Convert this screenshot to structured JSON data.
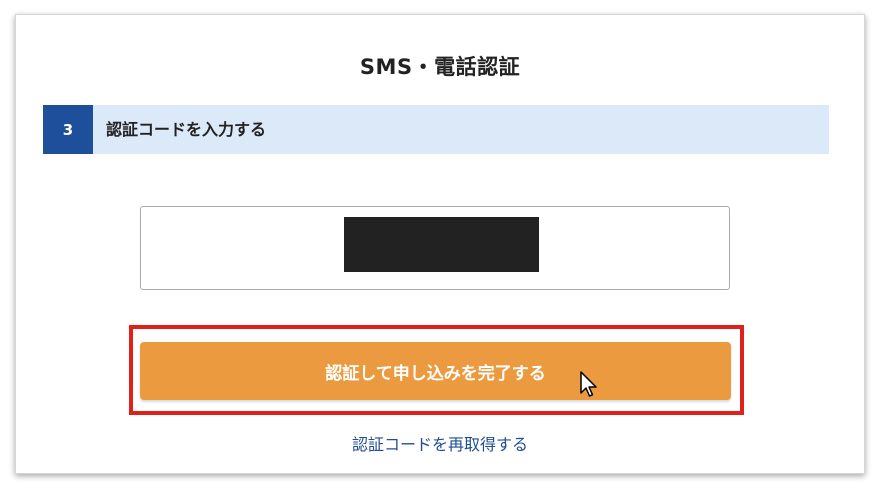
{
  "form": {
    "title": "SMS・電話認証",
    "step": {
      "number": "3",
      "label": "認証コードを入力する"
    },
    "code_input": {
      "redacted": true
    },
    "submit_label": "認証して申し込みを完了する",
    "resend_label": "認証コードを再取得する"
  },
  "colors": {
    "step_badge": "#1e4f9a",
    "step_bar": "#dbe9f8",
    "button": "#ec9a40",
    "highlight": "#e2201a",
    "link": "#1f4c94"
  },
  "icons": {
    "cursor": "arrow-cursor-icon"
  }
}
